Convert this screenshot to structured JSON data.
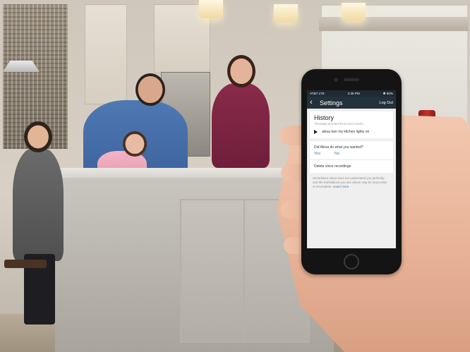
{
  "phone": {
    "status_left": "AT&T  LTE",
    "status_time": "2:35 PM",
    "status_right": "✱ 90%",
    "nav": {
      "title": "Settings",
      "logout_label": "Log Out"
    },
    "history": {
      "title": "History",
      "subtitle": "Thursday at 5:30 PM on Eric's Echo",
      "utterance": "alexa turn my kitchen lights on"
    },
    "feedback": {
      "question": "Did Alexa do what you wanted?",
      "yes_label": "Yes",
      "no_label": "No"
    },
    "delete_label": "Delete voice recordings",
    "disclaimer_text": "Sometimes Alexa does not understand you perfectly, and the translations you see above may be inaccurate or incomplete.",
    "learn_more_label": "Learn more"
  },
  "colors": {
    "nav_bg": "#23313b",
    "link": "#2a7fb8",
    "screen_bg": "#efefef"
  }
}
